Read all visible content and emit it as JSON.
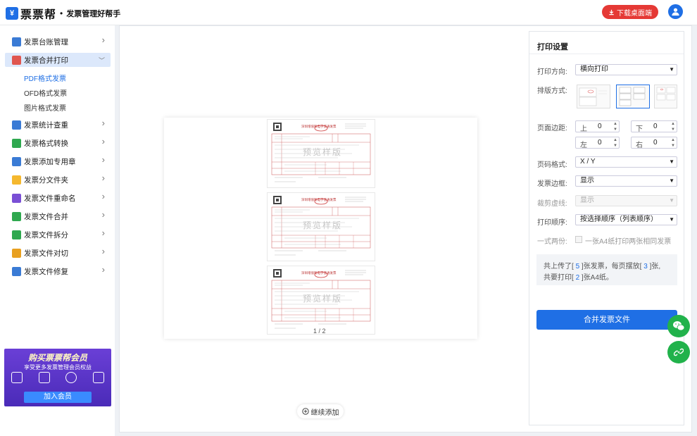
{
  "header": {
    "logo_letter": "¥",
    "logo_text": "票票帮",
    "separator": "•",
    "slogan": "发票管理好帮手",
    "download_label": "下载桌面端"
  },
  "sidebar": {
    "items": [
      {
        "label": "发票台账管理",
        "icon": "ledger-icon",
        "color": "#3a7bd5"
      },
      {
        "label": "发票合并打印",
        "icon": "printer-icon",
        "color": "#e0564f"
      },
      {
        "label": "发票统计查重",
        "icon": "statistics-icon",
        "color": "#3a7bd5"
      },
      {
        "label": "发票格式转换",
        "icon": "convert-icon",
        "color": "#2fa84f"
      },
      {
        "label": "发票添加专用章",
        "icon": "stamp-icon",
        "color": "#3a7bd5"
      },
      {
        "label": "发票分文件夹",
        "icon": "folder-icon",
        "color": "#f5b82e"
      },
      {
        "label": "发票文件重命名",
        "icon": "rename-icon",
        "color": "#7a4fd5"
      },
      {
        "label": "发票文件合并",
        "icon": "merge-icon",
        "color": "#2fa84f"
      },
      {
        "label": "发票文件拆分",
        "icon": "split-icon",
        "color": "#2fa84f"
      },
      {
        "label": "发票文件对切",
        "icon": "cut-icon",
        "color": "#e8a020"
      },
      {
        "label": "发票文件修复",
        "icon": "repair-icon",
        "color": "#3a7bd5"
      }
    ],
    "subitems": [
      "PDF格式发票",
      "OFD格式发票",
      "图片格式发票"
    ],
    "promo": {
      "title": "购买票票帮会员",
      "subtitle": "享受更多发票管理会员权益",
      "button": "加入会员"
    }
  },
  "preview": {
    "watermark": "预览样版",
    "invoice_title": "深圳增值税电子普通发票",
    "page_indicator": "1 / 2",
    "continue_label": "继续添加"
  },
  "settings": {
    "title": "打印设置",
    "orientation": {
      "label": "打印方向:",
      "value": "横向打印"
    },
    "layout": {
      "label": "排版方式:"
    },
    "margins": {
      "label": "页面边距:",
      "top": {
        "label": "上",
        "value": "0"
      },
      "bottom": {
        "label": "下",
        "value": "0"
      },
      "left": {
        "label": "左",
        "value": "0"
      },
      "right": {
        "label": "右",
        "value": "0"
      }
    },
    "page_format": {
      "label": "页码格式:",
      "value": "X / Y"
    },
    "border": {
      "label": "发票边框:",
      "value": "显示"
    },
    "cut_line": {
      "label": "裁剪虚线:",
      "value": "显示"
    },
    "order": {
      "label": "打印顺序:",
      "value": "按选择顺序（列表顺序）"
    },
    "duplicate": {
      "label": "一式两份:",
      "checkbox_label": "一张A4纸打印两张相同发票"
    },
    "summary": {
      "uploaded_pre": "共上传了[",
      "uploaded_count": "5",
      "uploaded_mid": "]张发票，每页摆放[",
      "per_page": "3",
      "uploaded_post": "]张,",
      "print_pre": "共要打印[",
      "sheets": "2",
      "print_post": "]张A4纸。"
    },
    "merge_button": "合并发票文件"
  }
}
